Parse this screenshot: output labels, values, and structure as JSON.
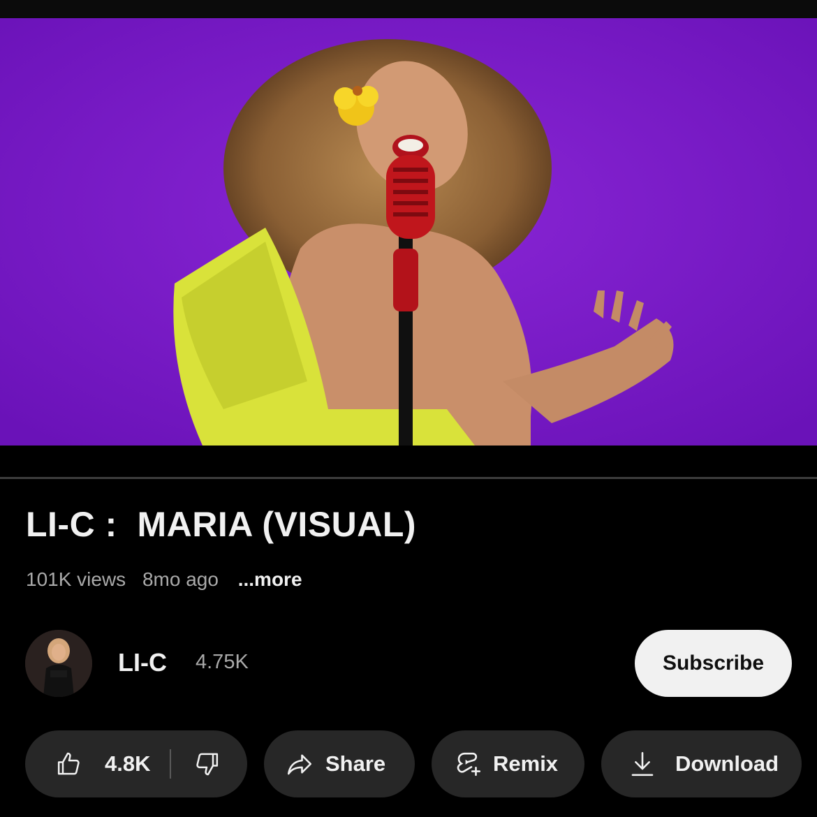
{
  "video": {
    "title": "LI-C :  MARIA (VISUAL)",
    "views": "101K views",
    "age": "8mo ago",
    "more_label": "...more",
    "progress": 0.0,
    "colors": {
      "background": "#7a1bc9",
      "dress": "#d9e23a",
      "microphone": "#c0161c"
    }
  },
  "channel": {
    "name": "LI-C",
    "subscribers": "4.75K",
    "subscribe_label": "Subscribe"
  },
  "actions": {
    "likes": "4.8K",
    "share_label": "Share",
    "remix_label": "Remix",
    "download_label": "Download",
    "icons": [
      "thumbs-up-icon",
      "thumbs-down-icon",
      "share-arrow-icon",
      "remix-icon",
      "download-icon"
    ]
  }
}
